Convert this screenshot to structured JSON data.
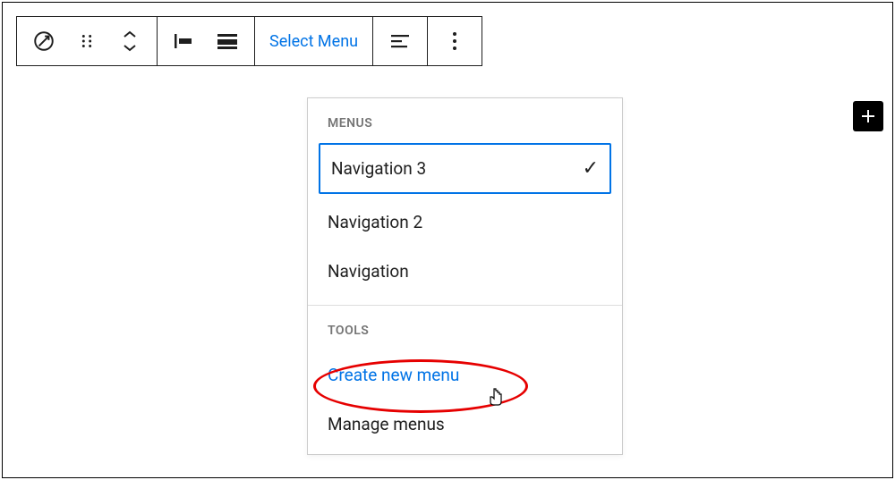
{
  "toolbar": {
    "select_menu_label": "Select Menu"
  },
  "dropdown": {
    "menus_header": "MENUS",
    "tools_header": "TOOLS",
    "menus": [
      {
        "label": "Navigation 3",
        "selected": true
      },
      {
        "label": "Navigation 2",
        "selected": false
      },
      {
        "label": "Navigation",
        "selected": false
      }
    ],
    "tools": [
      {
        "label": "Create new menu",
        "link": true
      },
      {
        "label": "Manage menus",
        "link": false
      }
    ]
  }
}
